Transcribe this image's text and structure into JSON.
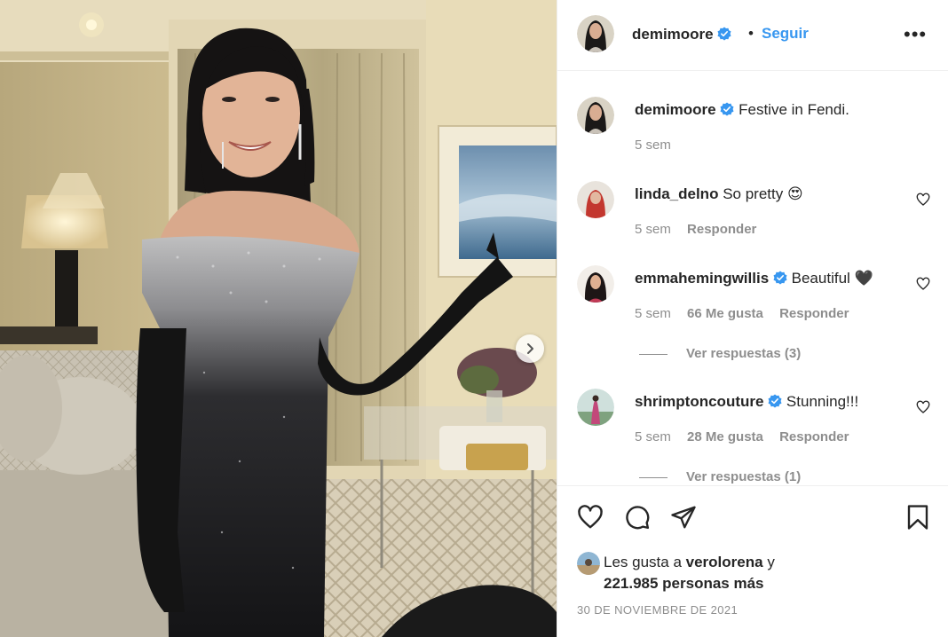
{
  "colors": {
    "link": "#3897f0",
    "verified": "#3897f0",
    "muted": "#8e8e8e",
    "text": "#262626"
  },
  "photo": {
    "description_icon": "carousel-next-icon"
  },
  "header": {
    "username": "demimoore",
    "separator": "•",
    "follow_label": "Seguir",
    "more_label": "•••"
  },
  "caption": {
    "username": "demimoore",
    "text": "Festive in Fendi.",
    "age": "5 sem"
  },
  "comments": [
    {
      "username": "linda_delno",
      "verified": false,
      "text": "So pretty 😍",
      "age": "5 sem",
      "likes": "",
      "reply_label": "Responder"
    },
    {
      "username": "emmahemingwillis",
      "verified": true,
      "text": "Beautiful 🖤",
      "age": "5 sem",
      "likes": "66 Me gusta",
      "reply_label": "Responder",
      "view_replies": "Ver respuestas (3)"
    },
    {
      "username": "shrimptoncouture",
      "verified": true,
      "text": "Stunning!!!",
      "age": "5 sem",
      "likes": "28 Me gusta",
      "reply_label": "Responder",
      "view_replies": "Ver respuestas (1)"
    }
  ],
  "likes": {
    "prefix": "Les gusta a",
    "liker": "verolorena",
    "conj": "y",
    "others": "221.985 personas más"
  },
  "date": "30 DE NOVIEMBRE DE 2021"
}
